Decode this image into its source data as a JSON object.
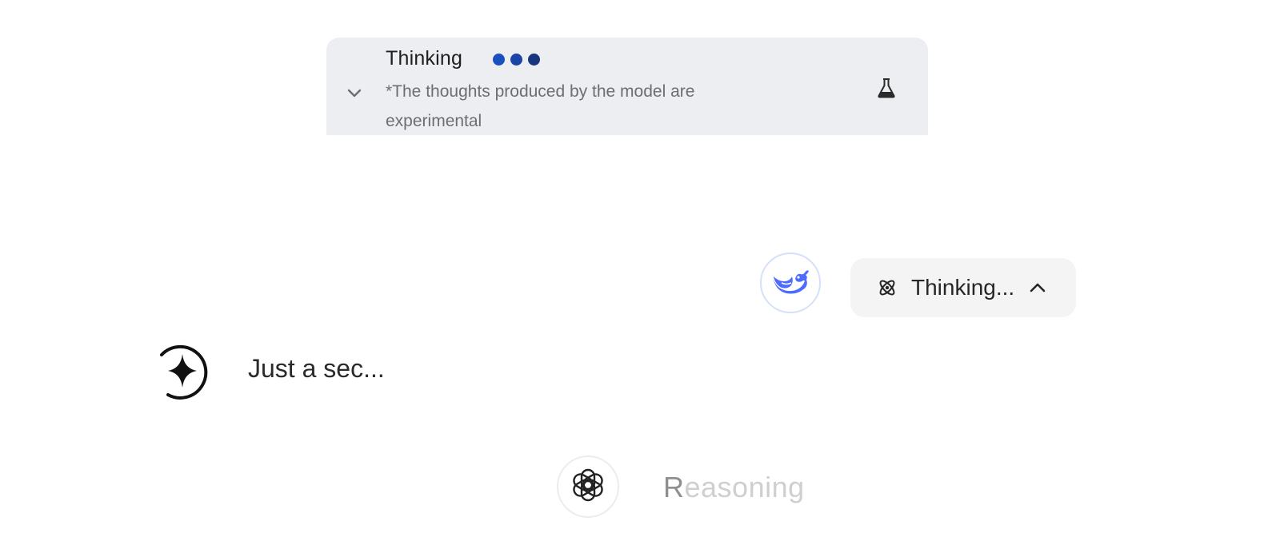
{
  "gemini": {
    "title": "Thinking",
    "note": "*The thoughts produced by the model are experimental",
    "icons": [
      "chevron-down-icon",
      "flask-icon"
    ],
    "dot_colors": [
      "#1a4fbf",
      "#1a44a8",
      "#17367f"
    ],
    "panel_color": "#edeef2"
  },
  "deepseek": {
    "label": "Thinking...",
    "icons": [
      "deepseek-whale-icon",
      "atom-icon",
      "chevron-up-icon"
    ],
    "brand_color": "#4d6bfe"
  },
  "copilot": {
    "text": "Just a sec...",
    "icon": "sparkle-ring-icon"
  },
  "chatgpt": {
    "text_first": "R",
    "text_rest": "easoning",
    "icon": "openai-knot-icon"
  }
}
